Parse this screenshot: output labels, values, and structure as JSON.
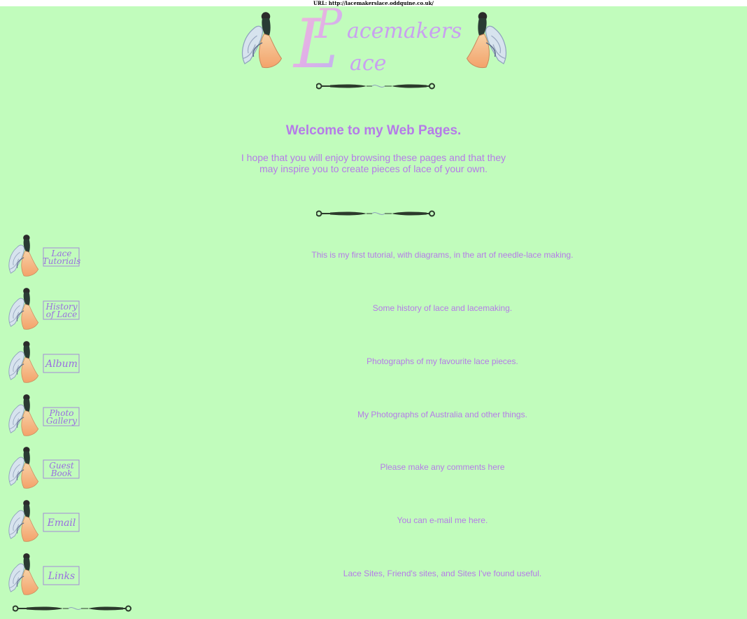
{
  "url_bar": {
    "text": "URL: http://lacemakerslace.oddquine.co.uk/"
  },
  "logo": {
    "title": "Lacemakers Lace"
  },
  "welcome": {
    "heading": "Welcome to my Web Pages."
  },
  "intro": {
    "line1": "I hope that you will enjoy browsing these pages and that they",
    "line2": "may inspire you to create pieces of lace of your own."
  },
  "nav": [
    {
      "button_line1": "Lace",
      "button_line2": "Tutorials",
      "description": "This is my first tutorial, with diagrams, in the art of needle-lace making."
    },
    {
      "button_line1": "History",
      "button_line2": "of Lace",
      "description": "Some history of lace and lacemaking."
    },
    {
      "button_line1": "Album",
      "button_line2": "",
      "description": "Photographs of my favourite lace pieces."
    },
    {
      "button_line1": "Photo",
      "button_line2": "Gallery",
      "description": "My Photographs of Australia and other things."
    },
    {
      "button_line1": "Guest",
      "button_line2": "Book",
      "description": "Please make any comments here"
    },
    {
      "button_line1": "Email",
      "button_line2": "",
      "description": "You can e-mail me here."
    },
    {
      "button_line1": "Links",
      "button_line2": "",
      "description": "Lace Sites, Friend's sites, and Sites I've found useful."
    }
  ],
  "colors": {
    "background": "#c1fcbc",
    "text": "#b57be8",
    "logo_pink": "#e8a6e0",
    "logo_violet": "#c9a0f0"
  }
}
